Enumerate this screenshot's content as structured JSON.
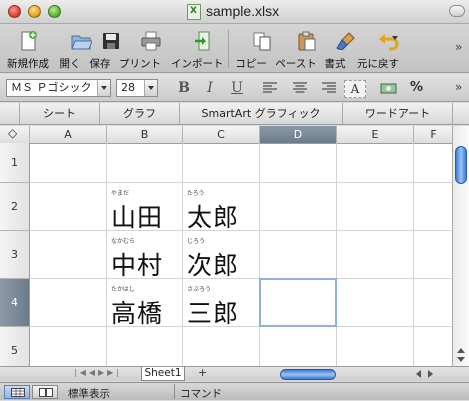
{
  "window": {
    "title": "sample.xlsx"
  },
  "toolbar": {
    "items": [
      {
        "label": "新規作成",
        "icon": "new-document-icon"
      },
      {
        "label": "開く",
        "icon": "open-folder-icon"
      },
      {
        "label": "保存",
        "icon": "save-disk-icon"
      },
      {
        "label": "プリント",
        "icon": "printer-icon"
      },
      {
        "label": "インポート",
        "icon": "import-icon"
      },
      {
        "label": "コピー",
        "icon": "copy-icon"
      },
      {
        "label": "ペースト",
        "icon": "paste-icon"
      },
      {
        "label": "書式",
        "icon": "format-brush-icon"
      },
      {
        "label": "元に戻す",
        "icon": "undo-icon"
      }
    ]
  },
  "format_bar": {
    "font_name": "ＭＳ Ｐゴシック",
    "font_size": "28",
    "bold": "B",
    "italic": "I",
    "underline": "U",
    "percent": "%"
  },
  "gallery_tabs": [
    "シート",
    "グラフ",
    "SmartArt グラフィック",
    "ワードアート"
  ],
  "columns": [
    "A",
    "B",
    "C",
    "D",
    "E",
    "F"
  ],
  "selected_column": "D",
  "rows": [
    "1",
    "2",
    "3",
    "4",
    "5"
  ],
  "selected_row": "4",
  "cells": {
    "B2": {
      "furigana": "やまだ",
      "text": "山田"
    },
    "C2": {
      "furigana": "たろう",
      "text": "太郎"
    },
    "B3": {
      "furigana": "なかむら",
      "text": "中村"
    },
    "C3": {
      "furigana": "じろう",
      "text": "次郎"
    },
    "B4": {
      "furigana": "たかはし",
      "text": "高橋"
    },
    "C4": {
      "furigana": "さぶろう",
      "text": "三郎"
    }
  },
  "sheet_tabs": [
    "Sheet1"
  ],
  "add_sheet": "+",
  "status": {
    "view_mode": "標準表示",
    "mode": "コマンド"
  }
}
